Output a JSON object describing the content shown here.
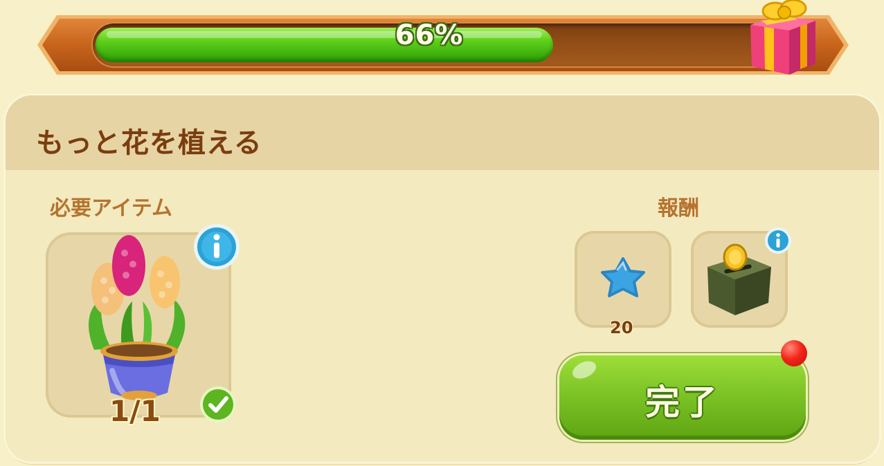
{
  "progress": {
    "percent": 66,
    "label": "66%"
  },
  "quest": {
    "title": "もっと花を植える"
  },
  "requirements": {
    "heading": "必要アイテム",
    "items": [
      {
        "icon": "hyacinth-pot-icon",
        "count": "1/1",
        "complete": true
      }
    ]
  },
  "rewards": {
    "heading": "報酬",
    "items": [
      {
        "icon": "blue-star-icon",
        "count": "20"
      },
      {
        "icon": "coin-chest-icon",
        "count": ""
      }
    ]
  },
  "actions": {
    "complete_label": "完了"
  },
  "colors": {
    "accent_green": "#7dc426",
    "banner_orange": "#c8641c",
    "title_brown": "#7a3d10",
    "notification_red": "#f3261a"
  }
}
